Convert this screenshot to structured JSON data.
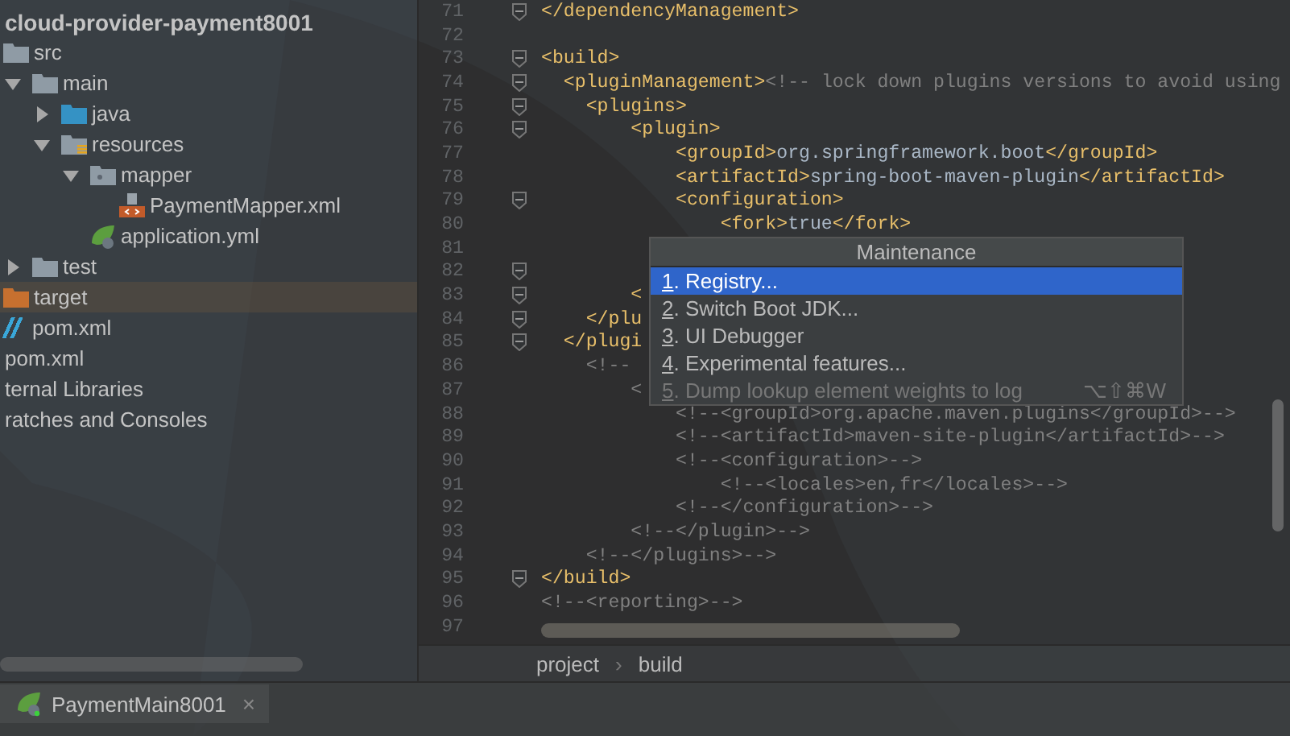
{
  "project_tree": [
    {
      "label": "cloud-provider-payment8001",
      "bold": true,
      "selected": false,
      "children": [
        {
          "label": "src",
          "kind": "folder",
          "selected": false,
          "children": [
            {
              "label": "main",
              "kind": "folder",
              "expanded": true,
              "selected": false,
              "children": [
                {
                  "label": "java",
                  "kind": "source-folder",
                  "expanded": false,
                  "selected": false
                },
                {
                  "label": "resources",
                  "kind": "resources-folder",
                  "expanded": true,
                  "selected": false,
                  "children": [
                    {
                      "label": "mapper",
                      "kind": "package-folder",
                      "expanded": true,
                      "selected": false,
                      "children": [
                        {
                          "label": "PaymentMapper.xml",
                          "kind": "xml-file",
                          "selected": false
                        }
                      ]
                    },
                    {
                      "label": "application.yml",
                      "kind": "spring-file",
                      "selected": false
                    }
                  ]
                }
              ]
            },
            {
              "label": "test",
              "kind": "folder",
              "expanded": false,
              "selected": false
            }
          ]
        },
        {
          "label": "target",
          "kind": "excluded-folder",
          "selected": true
        },
        {
          "label": "pom.xml",
          "kind": "maven-file",
          "selected": false
        }
      ]
    },
    {
      "label": "pom.xml",
      "selected": false
    },
    {
      "label": "ternal Libraries",
      "selected": false
    },
    {
      "label": "ratches and Consoles",
      "selected": false
    }
  ],
  "editor": {
    "lines": [
      {
        "number": "71",
        "fold_marker": true,
        "segments": [
          {
            "kind": "tag",
            "text": "</dependencyManagement>"
          }
        ]
      },
      {
        "number": "72",
        "fold_marker": false
      },
      {
        "number": "73",
        "fold_marker": true,
        "segments": [
          {
            "kind": "tag",
            "text": "<build>"
          }
        ]
      },
      {
        "number": "74",
        "fold_marker": true,
        "segments": [
          {
            "kind": "tag",
            "text": "  <pluginManagement>"
          },
          {
            "kind": "comment",
            "text": "<!-- lock down plugins versions to avoid using"
          }
        ]
      },
      {
        "number": "75",
        "fold_marker": true,
        "segments": [
          {
            "kind": "tag",
            "text": "    <plugins>"
          }
        ]
      },
      {
        "number": "76",
        "fold_marker": true,
        "segments": [
          {
            "kind": "tag",
            "text": "        <plugin>"
          }
        ]
      },
      {
        "number": "77",
        "fold_marker": false,
        "segments": [
          {
            "kind": "tag",
            "text": "            <groupId>"
          },
          {
            "kind": "text",
            "text": "org.springframework.boot"
          },
          {
            "kind": "tag",
            "text": "</groupId>"
          }
        ]
      },
      {
        "number": "78",
        "fold_marker": false,
        "segments": [
          {
            "kind": "tag",
            "text": "            <artifactId>"
          },
          {
            "kind": "text",
            "text": "spring-boot-maven-plugin"
          },
          {
            "kind": "tag",
            "text": "</artifactId>"
          }
        ]
      },
      {
        "number": "79",
        "fold_marker": true,
        "segments": [
          {
            "kind": "tag",
            "text": "            <configuration>"
          }
        ]
      },
      {
        "number": "80",
        "fold_marker": false,
        "segments": [
          {
            "kind": "tag",
            "text": "                <fork>"
          },
          {
            "kind": "text",
            "text": "true"
          },
          {
            "kind": "tag",
            "text": "</fork>"
          }
        ]
      },
      {
        "number": "81",
        "fold_marker": false
      },
      {
        "number": "82",
        "fold_marker": true
      },
      {
        "number": "83",
        "fold_marker": true,
        "segments": [
          {
            "kind": "tag",
            "text": "        <"
          }
        ]
      },
      {
        "number": "84",
        "fold_marker": true,
        "segments": [
          {
            "kind": "tag",
            "text": "    </plu"
          }
        ]
      },
      {
        "number": "85",
        "fold_marker": true,
        "segments": [
          {
            "kind": "tag",
            "text": "  </plugi"
          }
        ]
      },
      {
        "number": "86",
        "fold_marker": false,
        "segments": [
          {
            "kind": "comment",
            "text": "    <!--"
          }
        ]
      },
      {
        "number": "87",
        "fold_marker": false,
        "segments": [
          {
            "kind": "comment",
            "text": "        <"
          }
        ]
      },
      {
        "number": "88",
        "fold_marker": false,
        "segments": [
          {
            "kind": "comment",
            "text": "            <!--<groupId>org.apache.maven.plugins</groupId>-->"
          }
        ]
      },
      {
        "number": "89",
        "fold_marker": false,
        "segments": [
          {
            "kind": "comment",
            "text": "            <!--<artifactId>maven-site-plugin</artifactId>-->"
          }
        ]
      },
      {
        "number": "90",
        "fold_marker": false,
        "segments": [
          {
            "kind": "comment",
            "text": "            <!--<configuration>-->"
          }
        ]
      },
      {
        "number": "91",
        "fold_marker": false,
        "segments": [
          {
            "kind": "comment",
            "text": "                <!--<locales>en,fr</locales>-->"
          }
        ]
      },
      {
        "number": "92",
        "fold_marker": false,
        "segments": [
          {
            "kind": "comment",
            "text": "            <!--</configuration>-->"
          }
        ]
      },
      {
        "number": "93",
        "fold_marker": false,
        "segments": [
          {
            "kind": "comment",
            "text": "        <!--</plugin>-->"
          }
        ]
      },
      {
        "number": "94",
        "fold_marker": false,
        "segments": [
          {
            "kind": "comment",
            "text": "    <!--</plugins>-->"
          }
        ]
      },
      {
        "number": "95",
        "fold_marker": true,
        "segments": [
          {
            "kind": "tag",
            "text": "</build>"
          }
        ]
      },
      {
        "number": "96",
        "fold_marker": false,
        "segments": [
          {
            "kind": "comment",
            "text": "<!--<reporting>-->"
          }
        ]
      },
      {
        "number": "97",
        "fold_marker": false
      }
    ]
  },
  "breadcrumb": {
    "items": [
      "project",
      "build"
    ],
    "separator": "›"
  },
  "popup": {
    "title": "Maintenance",
    "items": [
      {
        "label": "1. Registry...",
        "selected": true,
        "disabled": false
      },
      {
        "label": "2. Switch Boot JDK...",
        "selected": false,
        "disabled": false
      },
      {
        "label": "3. UI Debugger",
        "selected": false,
        "disabled": false
      },
      {
        "label": "4. Experimental features...",
        "selected": false,
        "disabled": false
      },
      {
        "label": "5. Dump lookup element weights to log",
        "selected": false,
        "disabled": true,
        "shortcut": "⌥⇧⌘W"
      }
    ]
  },
  "run_tab": {
    "label": "PaymentMain8001",
    "close": "×"
  }
}
